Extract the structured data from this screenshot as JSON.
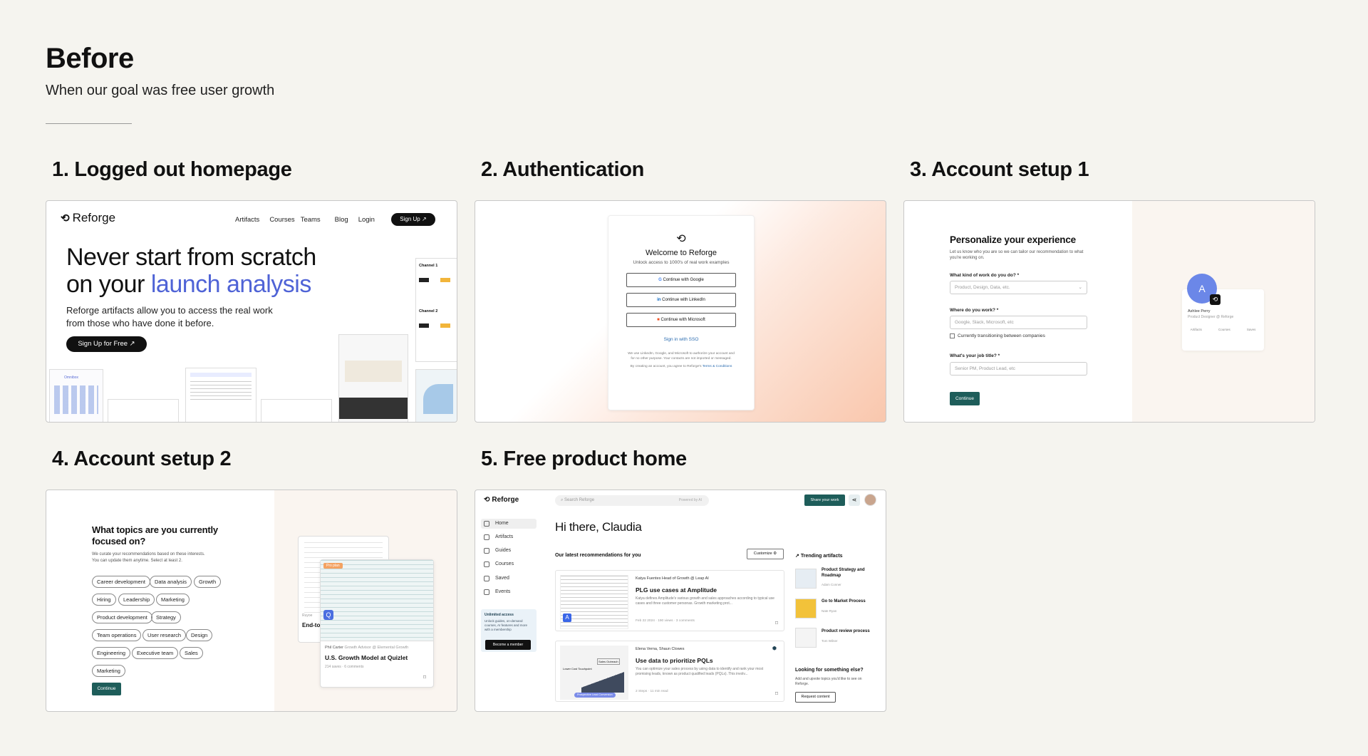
{
  "page": {
    "title": "Before",
    "subtitle": "When our goal was free user growth"
  },
  "sections": {
    "s1": "1. Logged out homepage",
    "s2": "2. Authentication",
    "s3": "3. Account setup 1",
    "s4": "4. Account setup 2",
    "s5": "5. Free product home"
  },
  "home": {
    "brand": "Reforge",
    "nav": [
      "Artifacts",
      "Courses",
      "Teams",
      "Blog",
      "Login"
    ],
    "signup": "Sign Up ↗",
    "headline_1": "Never start from scratch",
    "headline_2a": "on your ",
    "headline_2b": "launch analysis",
    "body_1": "Reforge artifacts allow you to access the real work",
    "body_2": "from those who have done it before.",
    "cta": "Sign Up for Free ↗",
    "channel_1": "Channel 1",
    "channel_2": "Channel 2"
  },
  "auth": {
    "title": "Welcome to Reforge",
    "subtitle": "Unlock access to 1000's of real work examples",
    "google": "Continue with Google",
    "linkedin": "Continue with LinkedIn",
    "microsoft": "Continue with Microsoft",
    "sso": "Sign in with SSO",
    "disclaimer": "We use LinkedIn, Google, and Microsoft to authorize your account and for no other purpose. Your contacts are not imported or messaged.",
    "terms_prefix": "By creating an account, you agree to Reforge's ",
    "terms_link": "Terms & Conditions"
  },
  "setup1": {
    "title": "Personalize your experience",
    "desc": "Let us know who you are so we can tailor our recommendation to what you're working on.",
    "q1": "What kind of work do you do? *",
    "q1_placeholder": "Product, Design, Data, etc.",
    "q2": "Where do you work? *",
    "q2_placeholder": "Google, Slack, Microsoft, etc",
    "checkbox": "Currently transitioning between companies",
    "q3": "What's your job title? *",
    "q3_placeholder": "Senior PM, Product Lead, etc",
    "continue": "Continue",
    "avatar_letter": "A",
    "profile_name": "Ashlee Perry",
    "profile_role": "Product Designer @ Reforge",
    "profile_tabs": [
      "Artifacts",
      "Courses",
      "Saves"
    ]
  },
  "setup2": {
    "title_1": "What topics are you currently",
    "title_2": "focused on?",
    "desc_1": "We curate your recommendations based on these interests.",
    "desc_2": "You can update them anytime. Select at least 2.",
    "chips": [
      "Career development",
      "Data analysis",
      "Growth",
      "Hiring",
      "Leadership",
      "Marketing",
      "Product development",
      "Strategy",
      "Team operations",
      "User research",
      "Design",
      "Engineering",
      "Executive team",
      "Sales",
      "Marketing"
    ],
    "continue": "Continue",
    "card_author": "Phil Carter",
    "card_author_role": "Growth Advisor @ Elemental Growth",
    "card_title": "U.S. Growth Model at Quizlet",
    "card_stats": "214 saves · 6 comments",
    "back_title": "End-to",
    "back_author": "Ruyoe",
    "tag": "Pro plan"
  },
  "product": {
    "brand": "Reforge",
    "search_placeholder": "Search Reforge",
    "powered": "Powered by AI",
    "share": "Share your work",
    "nav": [
      "Home",
      "Artifacts",
      "Guides",
      "Courses",
      "Saved",
      "Events"
    ],
    "promo_title": "Unlimited access",
    "promo_body": "Unlock guides, on-demand courses, AI features and more with a membership",
    "promo_cta": "Become a member",
    "greeting": "Hi there, Claudia",
    "recs_title": "Our latest recommendations for you",
    "customize": "Customize",
    "rec1_author": "Katya Fuentes Head of Growth @ Leap AI",
    "rec1_title": "PLG use cases at Amplitude",
    "rec1_body": "Katya defines Amplitude's various growth and sales approaches according to typical use cases and three customer personas. Growth marketing prot...",
    "rec1_meta": "Feb 22 2024 · 190 views · 3 comments",
    "rec2_author": "Elena Verna, Shaun Clowes",
    "rec2_title": "Use data to prioritize PQLs",
    "rec2_body": "You can optimize your sales process by using data to identify and rank your most promising leads, known as product qualified leads (PQLs). This involv...",
    "rec2_meta": "2 Steps · 11 min read",
    "rec2_thumb_a": "Lower Cost Touchpoint",
    "rec2_thumb_b": "Sales Outreach",
    "rec2_thumb_c": "Prospective Lead Conversion",
    "trending_title": "Trending artifacts",
    "trending": [
      {
        "title": "Product Strategy and Roadmap",
        "author": "Adam Conner"
      },
      {
        "title": "Go to Market Process",
        "author": "Nate Ryan"
      },
      {
        "title": "Product review process",
        "author": "Tom Wilner"
      }
    ],
    "else_title": "Looking for something else?",
    "else_body": "Add and upvote topics you'd like to see on Reforge.",
    "request": "Request content"
  }
}
